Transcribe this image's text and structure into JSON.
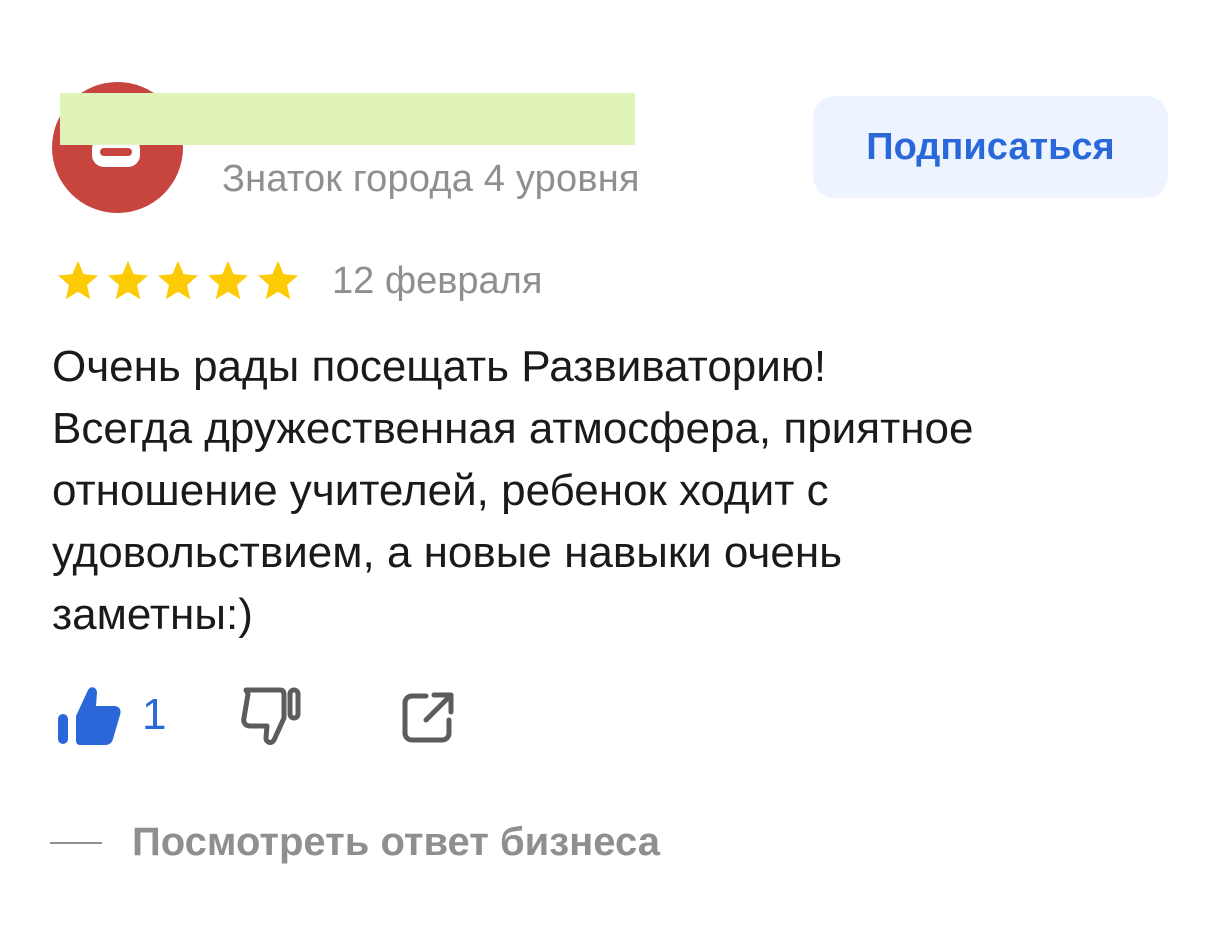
{
  "author": {
    "level": "Знаток города 4 уровня",
    "avatar_icon": "user-avatar-icon",
    "avatar_color": "#c7443f"
  },
  "subscribe": {
    "label": "Подписаться",
    "color": "#2a68d9"
  },
  "review": {
    "rating": 5,
    "rating_max": 5,
    "date": "12 февраля",
    "text_lines": [
      "Очень рады посещать Развиваторию!",
      "Всегда дружественная атмосфера, приятное",
      "отношение учителей, ребенок ходит с",
      "удовольствием, а новые навыки очень",
      "заметны:)"
    ]
  },
  "reactions": {
    "likes": "1",
    "like_icon": "thumbs-up-icon",
    "dislike_icon": "thumbs-down-icon",
    "share_icon": "share-icon"
  },
  "business_reply": {
    "label": "Посмотреть ответ бизнеса"
  },
  "colors": {
    "star": "#fccb05",
    "accent": "#2a68d9",
    "muted": "#8f8f8f"
  }
}
